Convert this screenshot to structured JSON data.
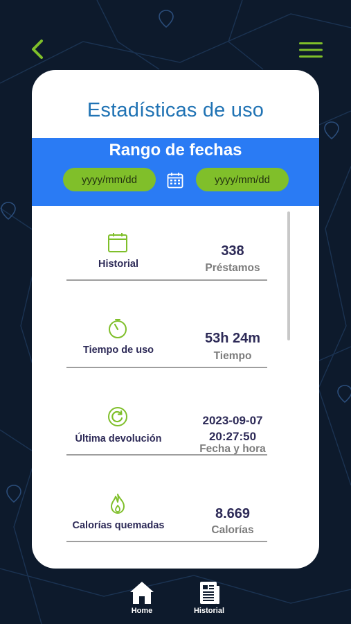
{
  "header": {
    "back_icon": "chevron-left-icon",
    "menu_icon": "hamburger-menu-icon",
    "accent_color": "#7fbf2a"
  },
  "card": {
    "title": "Estadísticas de uso",
    "range": {
      "title": "Rango de fechas",
      "from_placeholder": "yyyy/mm/dd",
      "to_placeholder": "yyyy/mm/dd",
      "calendar_icon": "calendar-icon"
    }
  },
  "stats": [
    {
      "icon": "calendar-icon",
      "label": "Historial",
      "value": "338",
      "unit": "Préstamos"
    },
    {
      "icon": "timer-icon",
      "label": "Tiempo de uso",
      "value": "53h 24m",
      "unit": "Tiempo"
    },
    {
      "icon": "return-icon",
      "label": "Última devolución",
      "value_date": "2023-09-07",
      "value_time": "20:27:50",
      "unit": "Fecha y hora"
    },
    {
      "icon": "flame-icon",
      "label": "Calorías quemadas",
      "value": "8.669",
      "unit": "Calorías"
    }
  ],
  "bottom_nav": [
    {
      "icon": "home-icon",
      "label": "Home"
    },
    {
      "icon": "history-document-icon",
      "label": "Historial"
    }
  ],
  "colors": {
    "background": "#0d1a2c",
    "title_blue": "#2073b4",
    "range_blue": "#2a7bf4",
    "input_green": "#80bf2a",
    "text_dark": "#2d2a57"
  }
}
